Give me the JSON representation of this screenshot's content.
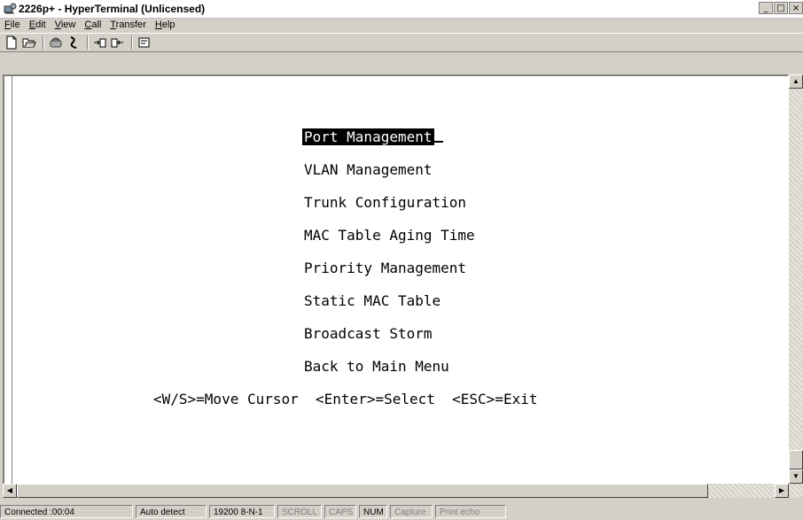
{
  "window": {
    "title": "2226p+ - HyperTerminal (Unlicensed)"
  },
  "menu": [
    {
      "label": "File"
    },
    {
      "label": "Edit"
    },
    {
      "label": "View"
    },
    {
      "label": "Call"
    },
    {
      "label": "Transfer"
    },
    {
      "label": "Help"
    }
  ],
  "toolbar": [
    "new-icon",
    "open-icon",
    "connect-icon",
    "disconnect-icon",
    "send-icon",
    "receive-icon",
    "properties-icon"
  ],
  "terminal": {
    "menu_items": [
      "Port Management",
      "VLAN Management",
      "Trunk Configuration",
      "MAC Table Aging Time",
      "Priority Management",
      "Static MAC Table",
      "Broadcast Storm",
      "Back to Main Menu"
    ],
    "selected_index": 0,
    "help_line": "<W/S>=Move Cursor  <Enter>=Select  <ESC>=Exit"
  },
  "status": {
    "connected": "Connected :00:04",
    "detect": "Auto detect",
    "baud": "19200 8-N-1",
    "scroll": "SCROLL",
    "caps": "CAPS",
    "num": "NUM",
    "capture": "Capture",
    "print": "Print echo"
  }
}
